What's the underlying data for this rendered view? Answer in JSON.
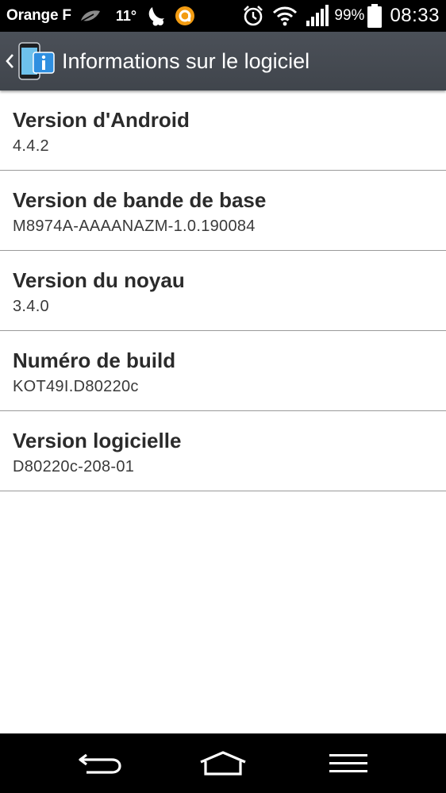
{
  "status_bar": {
    "carrier": "Orange F",
    "temperature": "11°",
    "battery_percent": "99%",
    "time": "08:33",
    "icons": [
      "leaf-icon",
      "weather-moon-icon",
      "notification-app-icon",
      "alarm-icon",
      "wifi-icon",
      "signal-icon",
      "battery-icon"
    ]
  },
  "action_bar": {
    "title": "Informations sur le logiciel",
    "icon": "software-info-icon",
    "accent": "#4a4f57"
  },
  "items": [
    {
      "title": "Version d'Android",
      "value": "4.4.2"
    },
    {
      "title": "Version de bande de base",
      "value": "M8974A-AAAANAZM-1.0.190084"
    },
    {
      "title": "Version du noyau",
      "value": "3.4.0"
    },
    {
      "title": "Numéro de build",
      "value": "KOT49I.D80220c"
    },
    {
      "title": "Version logicielle",
      "value": "D80220c-208-01"
    }
  ],
  "nav_bar": {
    "buttons": [
      "back-icon",
      "home-icon",
      "menu-icon"
    ]
  }
}
